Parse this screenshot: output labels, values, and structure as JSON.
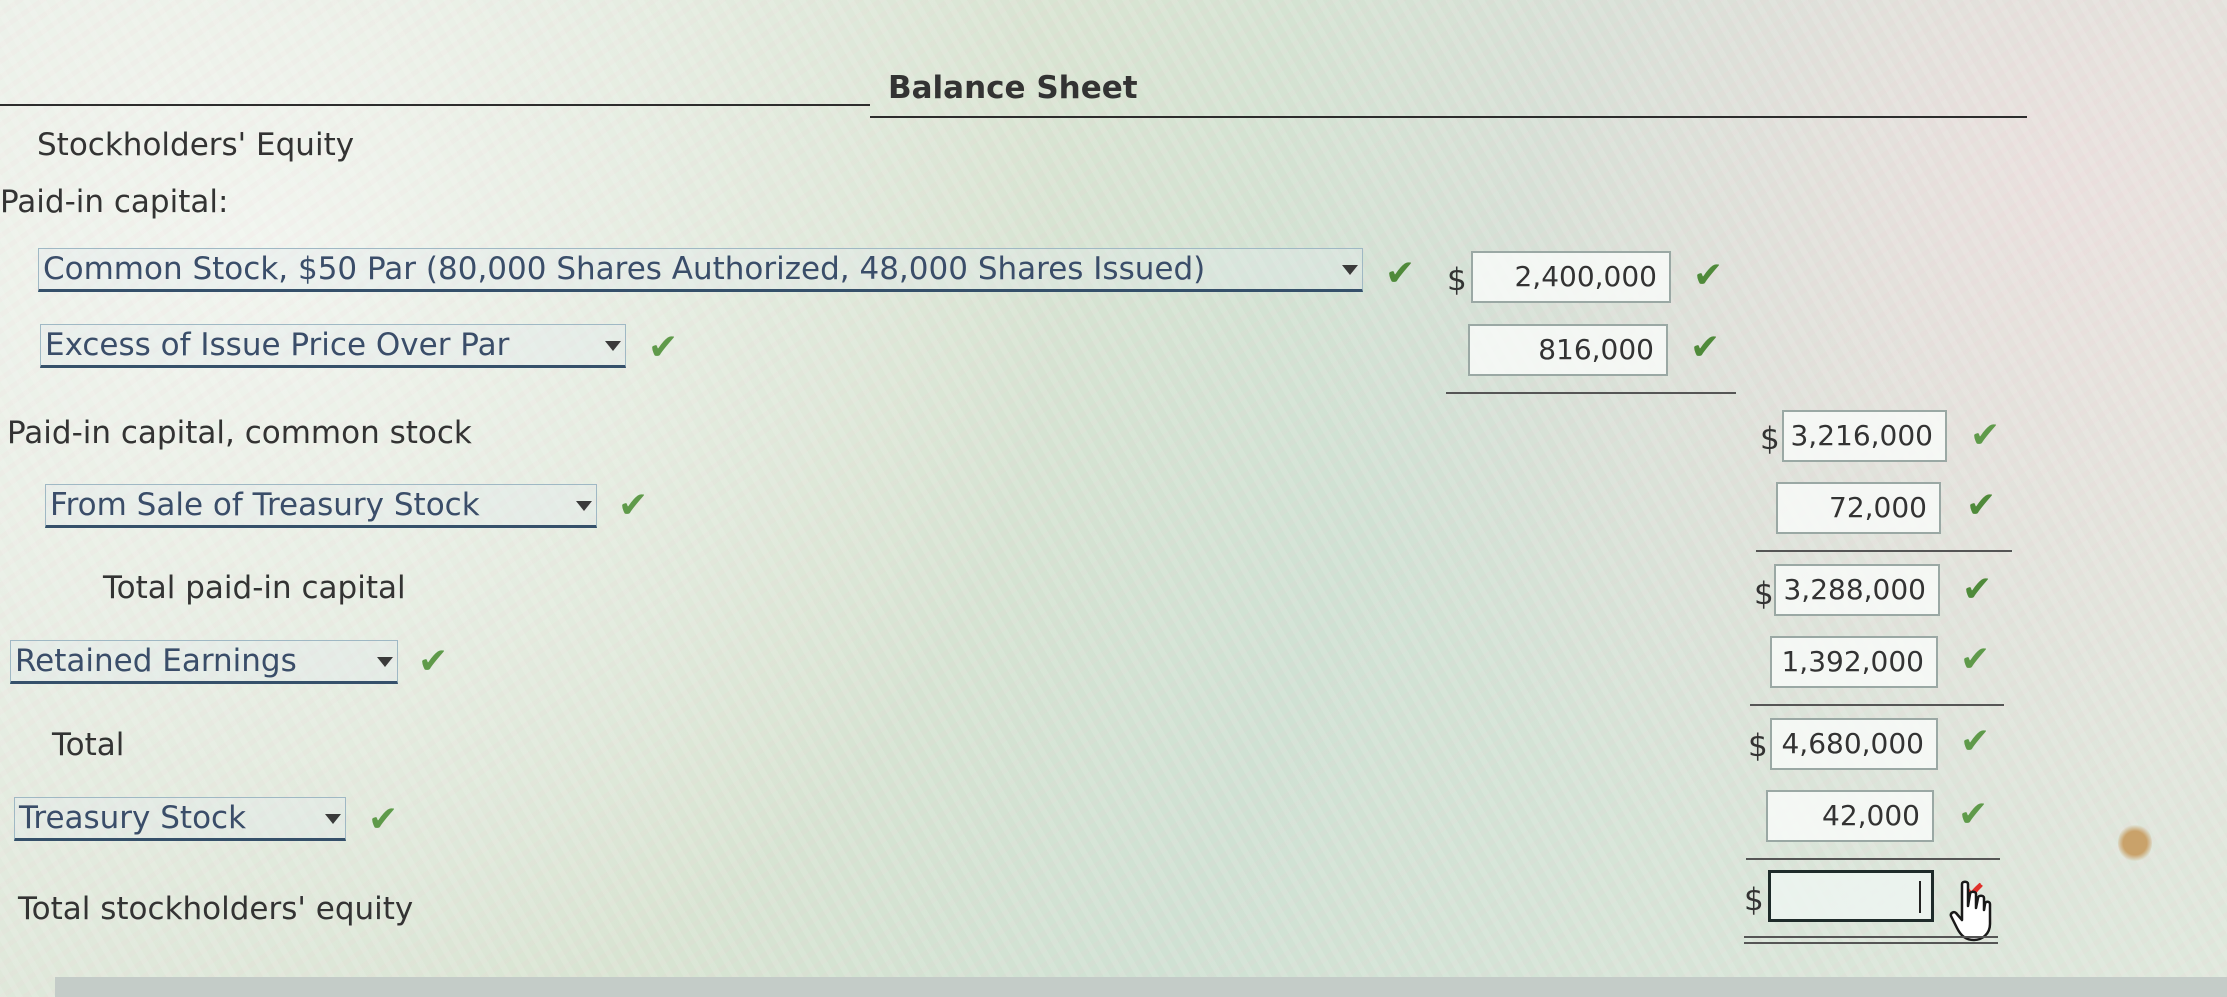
{
  "title": "Balance Sheet",
  "labels": {
    "section": "Stockholders' Equity",
    "paid_in_capital": "Paid-in capital:",
    "paid_in_common": "Paid-in capital, common stock",
    "total_paid_in": "Total paid-in capital",
    "total": "Total",
    "total_equity": "Total stockholders' equity"
  },
  "dropdowns": {
    "common_stock": "Common Stock, $50 Par (80,000 Shares Authorized, 48,000 Shares Issued)",
    "excess_par": "Excess of Issue Price Over Par",
    "treasury_sale": "From Sale of Treasury Stock",
    "retained": "Retained Earnings",
    "treasury_stock": "Treasury Stock"
  },
  "currency_symbol": "$",
  "amounts": {
    "common_stock": "2,400,000",
    "excess_par": "816,000",
    "paid_in_common": "3,216,000",
    "treasury_sale": "72,000",
    "total_paid_in": "3,288,000",
    "retained": "1,392,000",
    "total": "4,680,000",
    "treasury_stock": "42,000",
    "total_equity": ""
  },
  "status": {
    "correct_symbol": "✔",
    "incorrect_symbol": "✘"
  },
  "colors": {
    "correct": "#4f8a3a",
    "incorrect": "#e0302a",
    "dropdown_text": "#3a4d69"
  }
}
